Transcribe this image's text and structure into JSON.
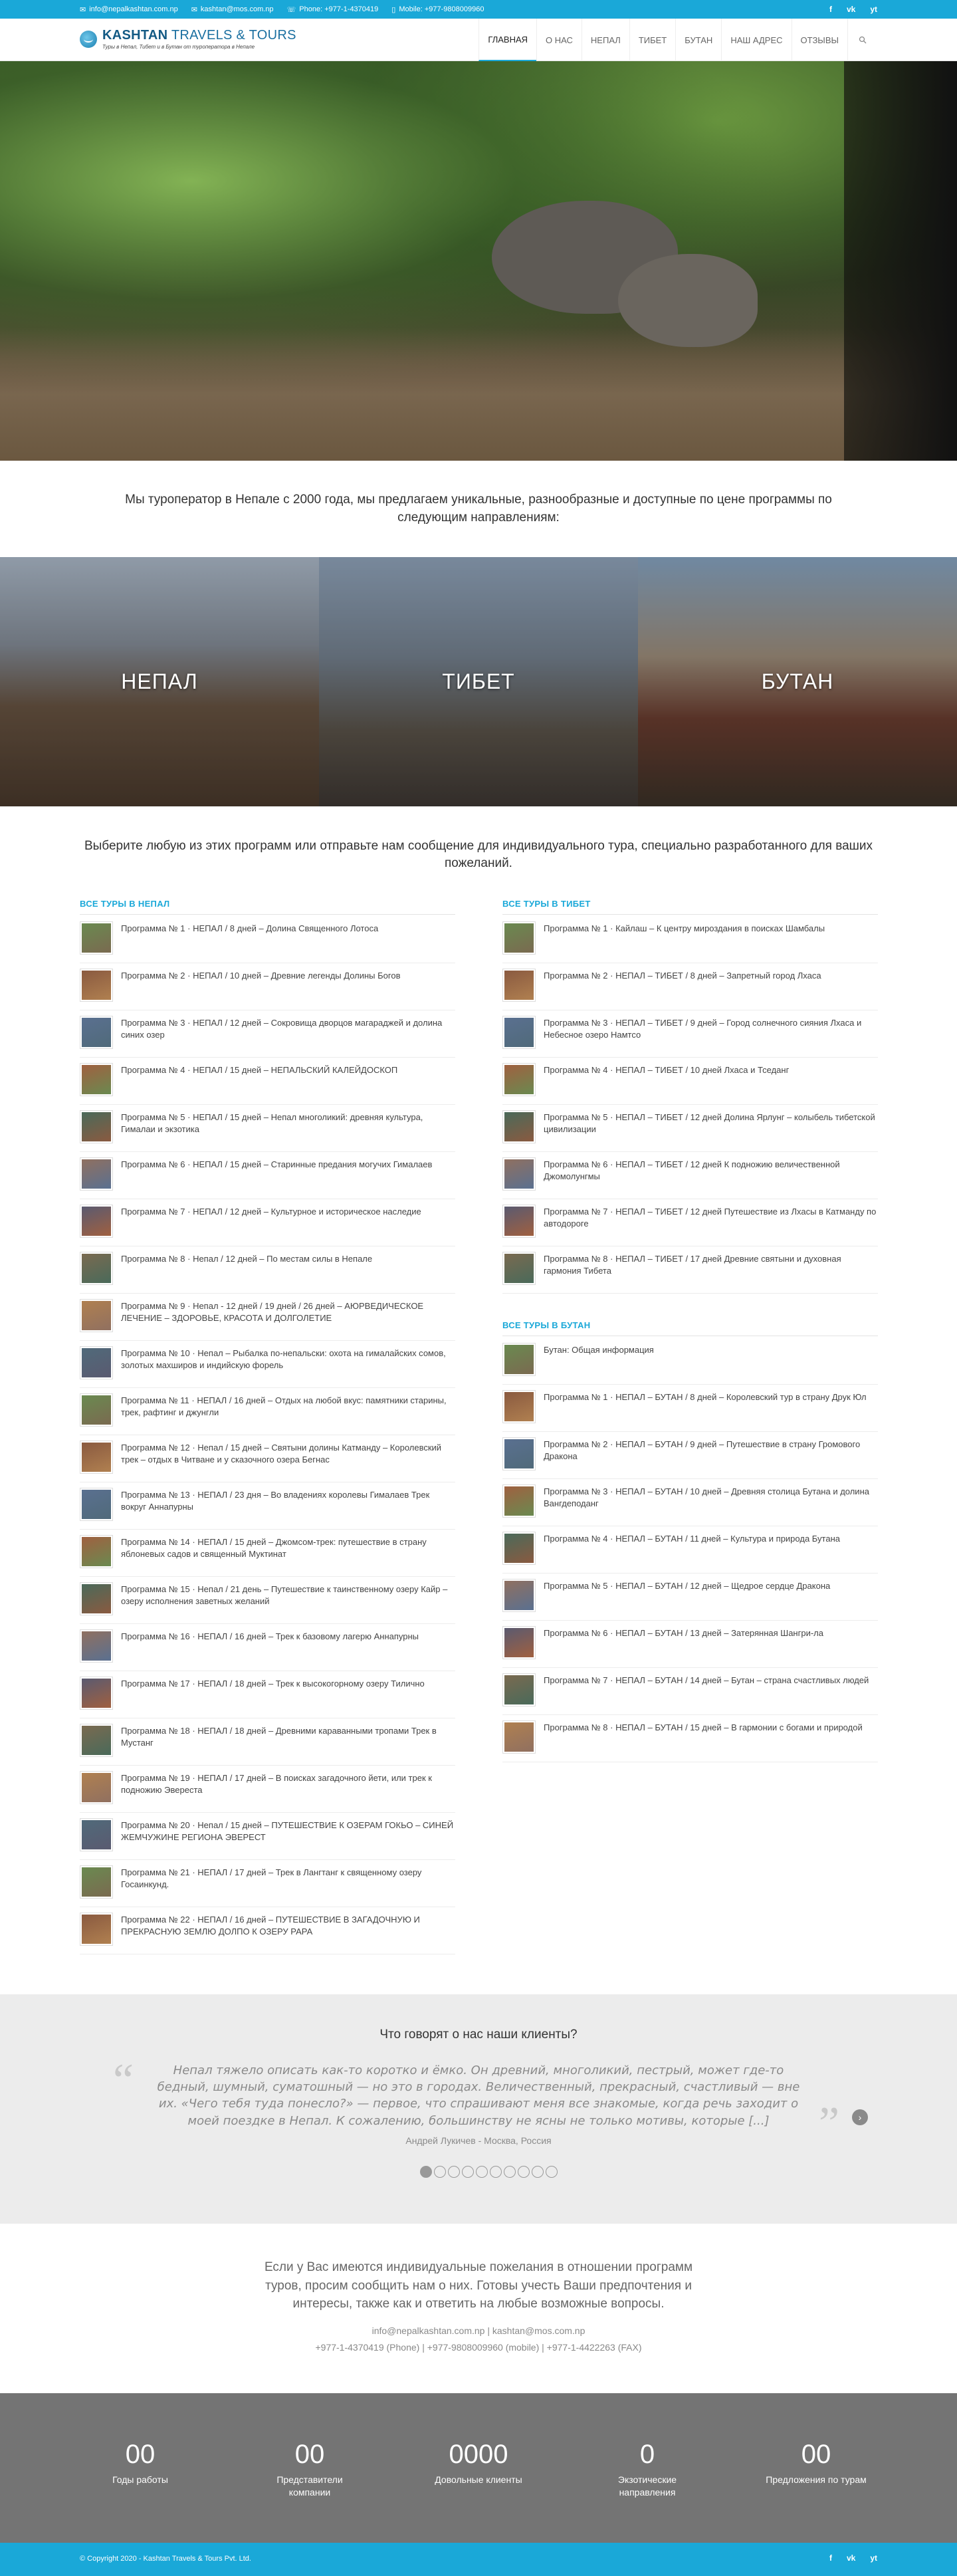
{
  "topbar": {
    "email1": "info@nepalkashtan.com.np",
    "email2": "kashtan@mos.com.np",
    "phone": "Phone: +977-1-4370419",
    "mobile": "Mobile: +977-9808009960",
    "social": [
      "f",
      "vk",
      "yt"
    ]
  },
  "header": {
    "logo_title_a": "KASHTAN",
    "logo_title_b": "TRAVELS & TOURS",
    "logo_subtitle": "Туры в Непал, Тибет и в Бутан от туроператора в Непале",
    "nav": [
      "ГЛАВНАЯ",
      "О НАС",
      "НЕПАЛ",
      "ТИБЕТ",
      "БУТАН",
      "НАШ АДРЕС",
      "ОТЗЫВЫ"
    ]
  },
  "intro": "Мы туроператор в Непале с 2000 года, мы предлагаем уникальные, разнообразные и доступные по цене программы по следующим направлениям:",
  "tiles": [
    "НЕПАЛ",
    "ТИБЕТ",
    "БУТАН"
  ],
  "choose": "Выберите любую из этих программ или отправьте нам сообщение для индивидуального тура, специально разработанного для ваших пожеланий.",
  "nepal": {
    "heading": "ВСЕ ТУРЫ В НЕПАЛ",
    "items": [
      "Программа № 1 · НЕПАЛ / 8 дней – Долина Священного Лотоса",
      "Программа № 2 · НЕПАЛ / 10 дней – Древние легенды Долины Богов",
      "Программа № 3 · НЕПАЛ / 12 дней – Сокровища дворцов магараджей и долина синих озер",
      "Программа № 4 · НЕПАЛ / 15 дней – НЕПАЛЬСКИЙ КАЛЕЙДОСКОП",
      "Программа № 5 · НЕПАЛ / 15 дней – Непал многоликий: древняя культура, Гималаи и экзотика",
      "Программа № 6 · НЕПАЛ / 15 дней – Старинные предания могучих Гималаев",
      "Программа № 7 · НЕПАЛ / 12 дней – Культурное и историческое наследие",
      "Программа № 8 · Непал / 12 дней – По местам силы в Непале",
      "Программа № 9 · Непал - 12 дней / 19 дней / 26 дней – АЮРВЕДИЧЕСКОЕ ЛЕЧЕНИЕ – ЗДОРОВЬЕ, КРАСОТА И ДОЛГОЛЕТИЕ",
      "Программа № 10 · Непал – Рыбалка по-непальски: охота на гималайских сомов, золотых махширов и индийскую форель",
      "Программа № 11 · НЕПАЛ / 16 дней – Отдых на любой вкус: памятники старины, трек, рафтинг и джунгли",
      "Программа № 12 · Непал / 15 дней – Святыни долины Катманду – Королевский трек – отдых в Читване и у сказочного озера Бегнас",
      "Программа № 13 · НЕПАЛ / 23 дня – Во владениях королевы Гималаев Трек вокруг Аннапурны",
      "Программа № 14 · НЕПАЛ / 15 дней – Джомсом-трек: путешествие в страну яблоневых садов и священный Муктинат",
      "Программа № 15 · Непал / 21 день – Путешествие к таинственному озеру Кайр – озеру исполнения заветных желаний",
      "Программа № 16 · НЕПАЛ / 16 дней – Трек к базовому лагерю Аннапурны",
      "Программа № 17 · НЕПАЛ / 18 дней – Трек к высокогорному озеру Тилично",
      "Программа № 18 · НЕПАЛ / 18 дней – Древними караванными тропами Трек в Мустанг",
      "Программа № 19 · НЕПАЛ / 17 дней – В поисках загадочного йети, или трек к подножию Эвереста",
      "Программа № 20 · Непал / 15 дней – ПУТЕШЕСТВИЕ К ОЗЕРАМ ГОКЬО – СИНЕЙ ЖЕМЧУЖИНЕ РЕГИОНА ЭВЕРЕСТ",
      "Программа № 21 · НЕПАЛ / 17 дней – Трек в Лангтанг к священному озеру Госаинкунд.",
      "Программа № 22 · НЕПАЛ / 16 дней – ПУТЕШЕСТВИЕ В ЗАГАДОЧНУЮ И ПРЕКРАСНУЮ ЗЕМЛЮ ДОЛПО К ОЗЕРУ РАРА"
    ]
  },
  "tibet": {
    "heading": "ВСЕ ТУРЫ В ТИБЕТ",
    "items": [
      "Программа № 1 · Кайлаш – К центру мироздания в поисках Шамбалы",
      "Программа № 2 · НЕПАЛ – ТИБЕТ / 8 дней – Запретный город Лхаса",
      "Программа № 3 · НЕПАЛ – ТИБЕТ / 9 дней – Город солнечного сияния Лхаса и Небесное озеро Намтсо",
      "Программа № 4 · НЕПАЛ – ТИБЕТ / 10 дней Лхаса и Тседанг",
      "Программа № 5 · НЕПАЛ – ТИБЕТ / 12 дней Долина Ярлунг – колыбель тибетской цивилизации",
      "Программа № 6 · НЕПАЛ – ТИБЕТ / 12 дней К подножию величественной Джомолунгмы",
      "Программа № 7 · НЕПАЛ – ТИБЕТ / 12 дней Путешествие из Лхасы в Катманду по автодороге",
      "Программа № 8 · НЕПАЛ – ТИБЕТ / 17 дней Древние святыни и духовная гармония Тибета"
    ]
  },
  "bhutan": {
    "heading": "ВСЕ ТУРЫ В БУТАН",
    "items": [
      "Бутан: Общая информация",
      "Программа № 1 · НЕПАЛ – БУТАН / 8 дней – Королевский тур в страну Друк Юл",
      "Программа № 2 · НЕПАЛ – БУТАН / 9 дней – Путешествие в страну Громового Дракона",
      "Программа № 3 · НЕПАЛ – БУТАН / 10 дней – Древняя столица Бутана и долина Вангдеподанг",
      "Программа № 4 · НЕПАЛ – БУТАН / 11 дней – Культура и природа Бутана",
      "Программа № 5 · НЕПАЛ – БУТАН / 12 дней – Щедрое сердце Дракона",
      "Программа № 6 · НЕПАЛ – БУТАН / 13 дней – Затерянная Шангри-ла",
      "Программа № 7 · НЕПАЛ – БУТАН / 14 дней – Бутан – страна счастливых людей",
      "Программа № 8 · НЕПАЛ – БУТАН / 15 дней – В гармонии с богами и природой"
    ]
  },
  "testimonials": {
    "heading": "Что говорят о нас наши клиенты?",
    "quote": "Непал тяжело описать как-то коротко и ёмко. Он древний, многоликий, пестрый, может где-то бедный, шумный, суматошный — но это в городах. Величественный, прекрасный, счастливый — вне их. «Чего тебя туда понесло?» — первое, что спрашивают меня все знакомые, когда речь заходит о моей поездке в Непал. К сожалению, большинству не ясны не только мотивы, которые [...]",
    "author": "Андрей Лукичев - Москва, Россия",
    "dots": 10,
    "active_dot": 0
  },
  "contact": {
    "lead": "Если у Вас имеются индивидуальные пожелания в отношении программ туров, просим сообщить нам о них. Готовы учесть Ваши предпочтения и интересы, также как и ответить на любые возможные вопросы.",
    "emails": "info@nepalkashtan.com.np | kashtan@mos.com.np",
    "phones": "+977-1-4370419 (Phone) | +977-9808009960 (mobile) | +977-1-4422263 (FAX)"
  },
  "stats": [
    {
      "num": "00",
      "label": "Годы работы"
    },
    {
      "num": "00",
      "label": "Представители компании"
    },
    {
      "num": "0000",
      "label": "Довольные клиенты"
    },
    {
      "num": "0",
      "label": "Экзотические направления"
    },
    {
      "num": "00",
      "label": "Предложения по турам"
    }
  ],
  "footer": {
    "copyright": "© Copyright 2020 - Kashtan Travels & Tours Pvt. Ltd."
  },
  "colors": {
    "accent": "#1aa8d8",
    "stats_bg": "#747474",
    "testimonial_bg": "#ececec"
  }
}
